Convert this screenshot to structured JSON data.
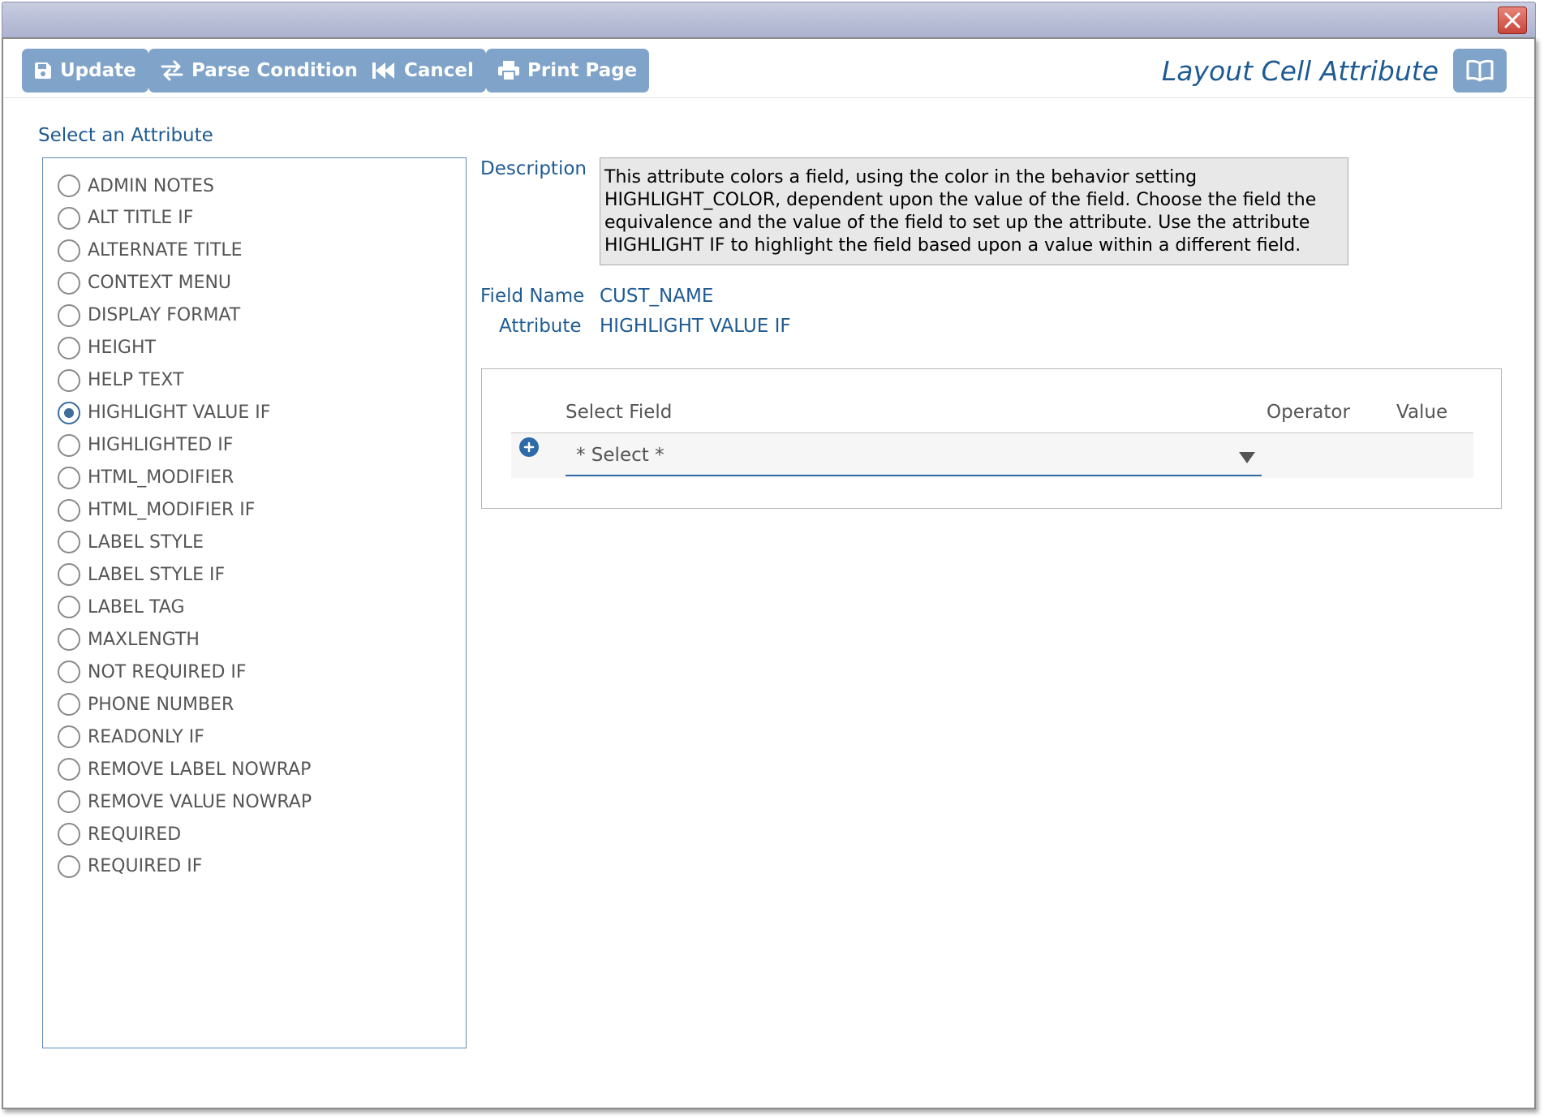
{
  "window": {
    "close_icon": "close-icon"
  },
  "toolbar": {
    "update_label": "Update",
    "parse_condition_label": "Parse Condition",
    "cancel_label": "Cancel",
    "print_page_label": "Print Page",
    "page_title": "Layout Cell Attribute",
    "button_color": "#7fa3c9"
  },
  "attributes": {
    "section_label": "Select an Attribute",
    "selected": "HIGHLIGHT VALUE IF",
    "items": [
      {
        "label": "ADMIN NOTES",
        "checked": false
      },
      {
        "label": "ALT TITLE IF",
        "checked": false
      },
      {
        "label": "ALTERNATE TITLE",
        "checked": false
      },
      {
        "label": "CONTEXT MENU",
        "checked": false
      },
      {
        "label": "DISPLAY FORMAT",
        "checked": false
      },
      {
        "label": "HEIGHT",
        "checked": false
      },
      {
        "label": "HELP TEXT",
        "checked": false
      },
      {
        "label": "HIGHLIGHT VALUE IF",
        "checked": true
      },
      {
        "label": "HIGHLIGHTED IF",
        "checked": false
      },
      {
        "label": "HTML_MODIFIER",
        "checked": false
      },
      {
        "label": "HTML_MODIFIER IF",
        "checked": false
      },
      {
        "label": "LABEL STYLE",
        "checked": false
      },
      {
        "label": "LABEL STYLE IF",
        "checked": false
      },
      {
        "label": "LABEL TAG",
        "checked": false
      },
      {
        "label": "MAXLENGTH",
        "checked": false
      },
      {
        "label": "NOT REQUIRED IF",
        "checked": false
      },
      {
        "label": "PHONE NUMBER",
        "checked": false
      },
      {
        "label": "READONLY IF",
        "checked": false
      },
      {
        "label": "REMOVE LABEL NOWRAP",
        "checked": false
      },
      {
        "label": "REMOVE VALUE NOWRAP",
        "checked": false
      },
      {
        "label": "REQUIRED",
        "checked": false
      },
      {
        "label": "REQUIRED IF",
        "checked": false
      }
    ]
  },
  "details": {
    "description_label": "Description",
    "description_lines": [
      "This attribute colors a field, using the color in the behavior setting",
      "HIGHLIGHT_COLOR, dependent upon the value of the field. Choose the field the",
      "equivalence and the value of the field to set up the attribute. Use the attribute",
      "HIGHLIGHT IF to highlight the field based upon a value within a different field."
    ],
    "field_name_label": "Field Name",
    "field_name_value": "CUST_NAME",
    "attribute_label": "Attribute",
    "attribute_value": "HIGHLIGHT VALUE IF"
  },
  "condition": {
    "columns": {
      "select_field": "Select Field",
      "operator": "Operator",
      "value": "Value"
    },
    "select_value": "* Select *"
  },
  "colors": {
    "accent": "#1f5b93",
    "selected_radio": "#3c6d9b"
  }
}
